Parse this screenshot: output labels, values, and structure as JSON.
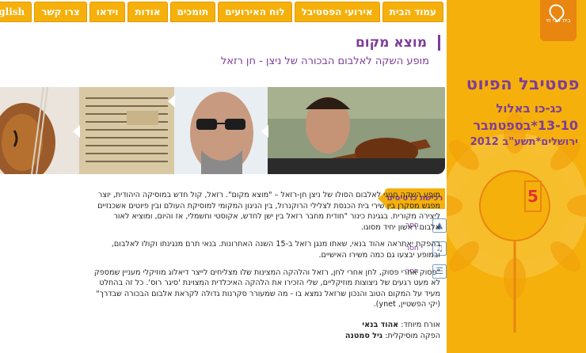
{
  "nav": {
    "items": [
      "עמוד הבית",
      "אירועי הפסטיבל",
      "לוח האירועים",
      "תומכים",
      "אודות",
      "וידאו",
      "צרו קשר",
      "English"
    ]
  },
  "sidebar": {
    "logo_text": "בית אבי חי",
    "title": "פסטיבל הפיוט",
    "date_hebrew": "כג-כו באלול",
    "date_gregorian": "13-10*בספטמבר",
    "location_year": "ירושלים*תשע\"ב 2012",
    "badge": "5"
  },
  "content": {
    "title": "מוצא מקום",
    "subtitle": "מופע השקה לאלבום הבכורה של ניצן - חן רזאל",
    "ticket_label": "רכישת כרטיסים",
    "side_links": [
      "חסר",
      "חסר",
      "חסר"
    ],
    "paragraph1": "מופע השקה חגיגי לאלבום הסולו של ניצן חן-רזאל – \"מוצא מקום\". רזאל, קול חדש במוסיקה היהודית, יוצר מפגש מסקרן בין שירי בית הכנסת לצלילי הרוקנרול, בין הניגון המקומי למוסיקת העולם ובין פיוטים אשכנזיים ליצירה מקורית. בגגינת כינור \"חודית מחבר רזאל בין ישן לחדש, אקוסטי וחשמלי, אז והיום, ומוציא לאור אלבום ראשון יחיד מסוגו.",
    "paragraph2": "בהפקת יאתראה אהוד בנאי, שאתו מנגן רזאל ב-15 השנה האחרונות. בנאי תרם מנגינתו וקולו לאלבום, ובמופע יבצעו גם כמה משירו האישיים.",
    "paragraph3": "\"פסוק אחרי פסוק, לחן אחרי לחן, רזאל והלהקה המצינות שלו מצליחים לייצר דיאלוג מוזיקלי מעניין שמספק לא מעט רגעים של ניצוצות מוזיקליים, שלי הזכירו את הלהקה האיכלדית המצוינת 'סיגר רוס'. כל זה בהחלט מעיד על המקום הטוב והנכון שרזאל נמצא בו - מה שמעורר סקרנות גדולה לקראת אלבום הבכורה שבדרך\" (יקי הפשטיין, ynet).",
    "credit1_label": "אורח מיוחד:",
    "credit1_value": "אהוד בנאי",
    "credit2_label": "הפקה מוסיקלית:",
    "credit2_value": "גיל סמטנה"
  },
  "colors": {
    "accent": "#f5b00b",
    "purple": "#7d3d99"
  }
}
